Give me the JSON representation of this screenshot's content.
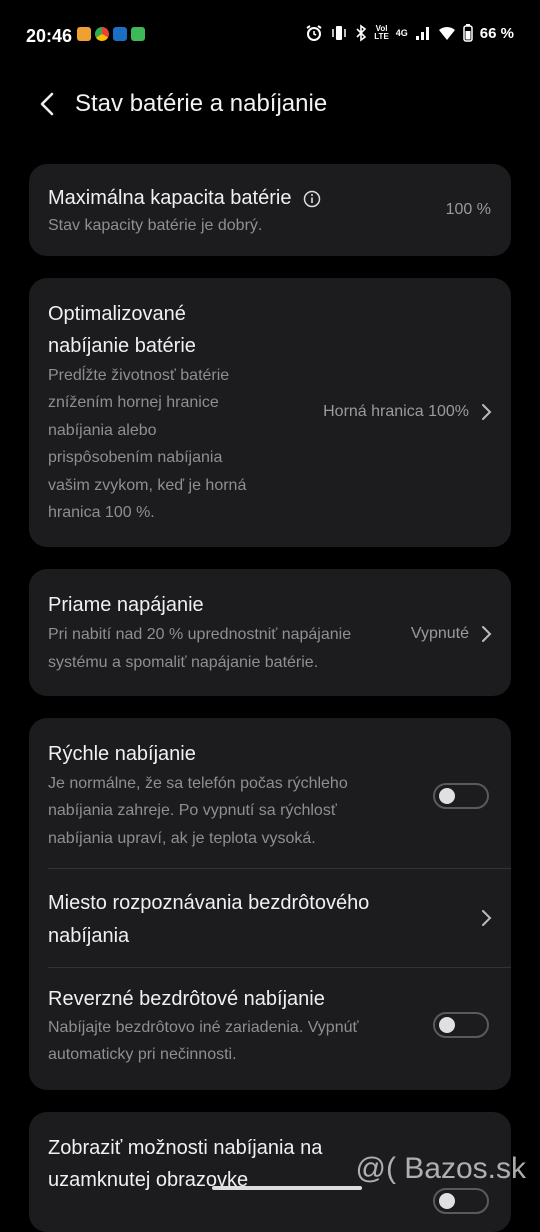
{
  "status_bar": {
    "time": "20:46",
    "battery_percent": "66 %",
    "net_top": "Vol",
    "net_bottom": "LTE",
    "net_gen": "4G"
  },
  "header": {
    "title": "Stav batérie a nabíjanie"
  },
  "max_capacity": {
    "title": "Maximálna kapacita batérie",
    "subtitle": "Stav kapacity batérie je dobrý.",
    "value": "100 %"
  },
  "optimized": {
    "title_lines": [
      "Optimalizované",
      "nabíjanie batérie"
    ],
    "subtitle_lines": [
      "Predĺžte životnosť batérie",
      "znížením hornej hranice",
      "nabíjania alebo",
      "prispôsobením nabíjania",
      "vašim zvykom, keď je horná",
      "hranica 100 %."
    ],
    "value": "Horná hranica 100%"
  },
  "direct_power": {
    "title": "Priame napájanie",
    "subtitle_lines": [
      "Pri nabití nad 20 % uprednostniť napájanie",
      "systému a spomaliť napájanie batérie."
    ],
    "value": "Vypnuté"
  },
  "fast_charging": {
    "title": "Rýchle nabíjanie",
    "subtitle_lines": [
      "Je normálne, že sa telefón počas rýchleho",
      "nabíjania zahreje. Po vypnutí sa rýchlosť",
      "nabíjania upraví, ak je teplota vysoká."
    ],
    "enabled": false
  },
  "wireless_location": {
    "title_lines": [
      "Miesto rozpoznávania bezdrôtového",
      "nabíjania"
    ]
  },
  "reverse_wireless": {
    "title": "Reverzné bezdrôtové nabíjanie",
    "subtitle_lines": [
      "Nabíjajte bezdrôtovo iné zariadenia. Vypnúť",
      "automaticky pri nečinnosti."
    ],
    "enabled": false
  },
  "lockscreen": {
    "title_lines": [
      "Zobraziť možnosti nabíjania na",
      "uzamknutej obrazovke"
    ]
  },
  "watermark": "@( Bazos.sk",
  "colors": {
    "background": "#000000",
    "card": "#1c1c1e",
    "secondary_text": "#8e8e93"
  }
}
